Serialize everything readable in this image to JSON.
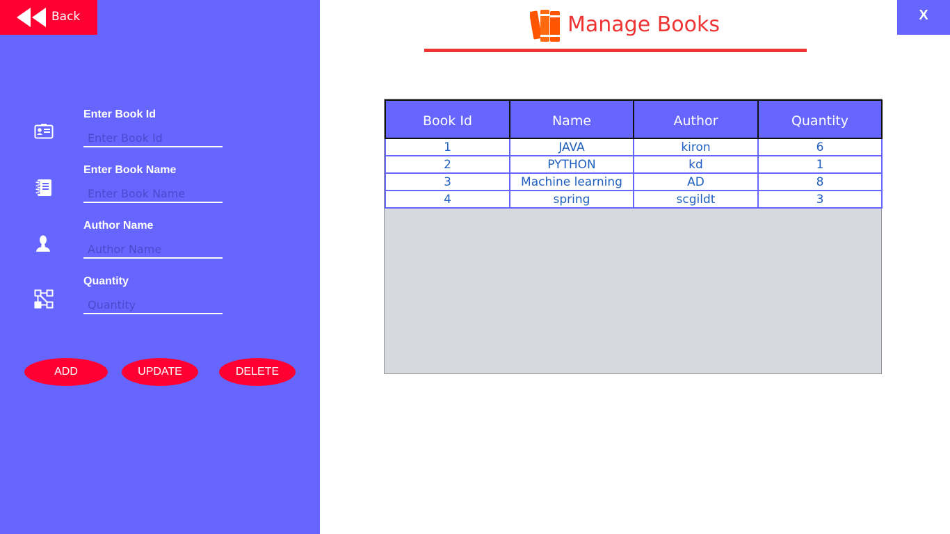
{
  "nav": {
    "back_label": "Back",
    "close_label": "X"
  },
  "header": {
    "title": "Manage Books"
  },
  "form": {
    "fields": [
      {
        "label": "Enter Book Id",
        "placeholder": "Enter Book Id",
        "value": "",
        "icon": "id-card-icon"
      },
      {
        "label": "Enter Book Name",
        "placeholder": "Enter Book Name",
        "value": "",
        "icon": "notebook-icon"
      },
      {
        "label": "Author Name",
        "placeholder": "Author Name",
        "value": "",
        "icon": "user-icon"
      },
      {
        "label": "Quantity",
        "placeholder": "Quantity",
        "value": "",
        "icon": "network-icon"
      }
    ],
    "buttons": {
      "add": "ADD",
      "update": "UPDATE",
      "delete": "DELETE"
    }
  },
  "table": {
    "columns": [
      "Book Id",
      "Name",
      "Author",
      "Quantity"
    ],
    "rows": [
      [
        "1",
        "JAVA",
        "kiron",
        "6"
      ],
      [
        "2",
        "PYTHON",
        "kd",
        "1"
      ],
      [
        "3",
        "Machine learning",
        "AD",
        "8"
      ],
      [
        "4",
        "spring",
        "scgildt",
        "3"
      ]
    ]
  },
  "colors": {
    "panel": "#6666ff",
    "accent_red": "#ff0033",
    "title_red": "#ee3333",
    "cell_text": "#1f5fbf",
    "table_empty": "#d7d9e0"
  }
}
